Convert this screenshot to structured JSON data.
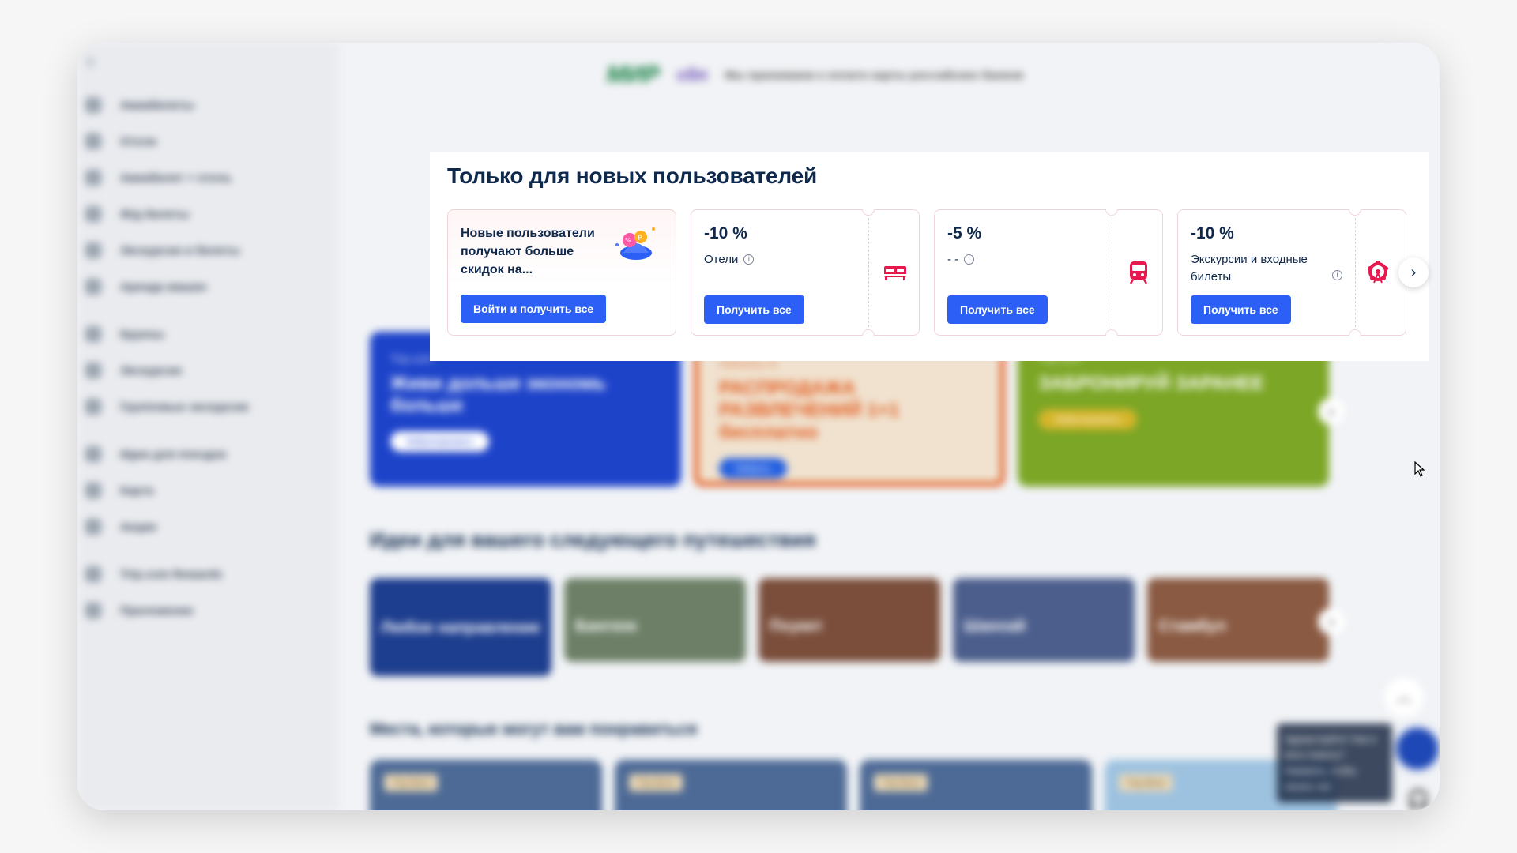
{
  "background": {
    "sidebar_items": [
      "Авиабилеты",
      "Отели",
      "Авиабилет + отель",
      "Ж/д билеты",
      "Экскурсии и билеты",
      "Аренда машин"
    ],
    "sidebar_items2": [
      "Круизы",
      "Экскурсии",
      "Групповые экскурсии"
    ],
    "sidebar_items3": [
      "Идеи для поездок",
      "Карта",
      "Акции"
    ],
    "sidebar_items4": [
      "Trip.com Rewards",
      "Приложение"
    ],
    "top_notice": "Мы принимаем к оплате карты российских банков",
    "mir_logo": "МИР",
    "sbp_logo": "сбп",
    "promos": [
      {
        "brand": "Trip.com",
        "title": "Живи дольше экономь больше",
        "button": "Забронировать"
      },
      {
        "brand": "Наконец-то",
        "title": "РАСПРОДАЖА РАЗВЛЕЧЕНИЙ 1+1 бесплатно",
        "button": "Забрать"
      },
      {
        "brand": "Trip.com",
        "title": "ЗАБРОНИРУЙ ЗАРАНЕЕ",
        "button": "Забронировать"
      }
    ],
    "ideas_title": "Идеи для вашего следующего путешествия",
    "ideas": [
      "Любое направление",
      "Бангкок",
      "Пхукет",
      "Шанхай",
      "Стамбул"
    ],
    "places_title": "Места, которые могут вам понравиться",
    "place_tag": "Trip.Best",
    "chat_tip": "Здравствуйте! Чем я могу помочь? Нажмите, чтобы начать чат"
  },
  "modal": {
    "title": "Только для новых пользователей",
    "first_card": {
      "text": "Новые пользователи получают больше скидок на...",
      "button": "Войти и получить все",
      "icon": "gift-hat-icon"
    },
    "cards": [
      {
        "discount": "-10 %",
        "category": "Отели",
        "button": "Получить все",
        "icon": "bed-icon"
      },
      {
        "discount": "-5 %",
        "category": "- -",
        "button": "Получить все",
        "icon": "train-icon"
      },
      {
        "discount": "-10 %",
        "category": "Экскурсии и входные билеты",
        "button": "Получить все",
        "icon": "ferris-wheel-icon"
      }
    ],
    "accent_color": "#2c5ff6",
    "icon_color": "#e8184f"
  }
}
